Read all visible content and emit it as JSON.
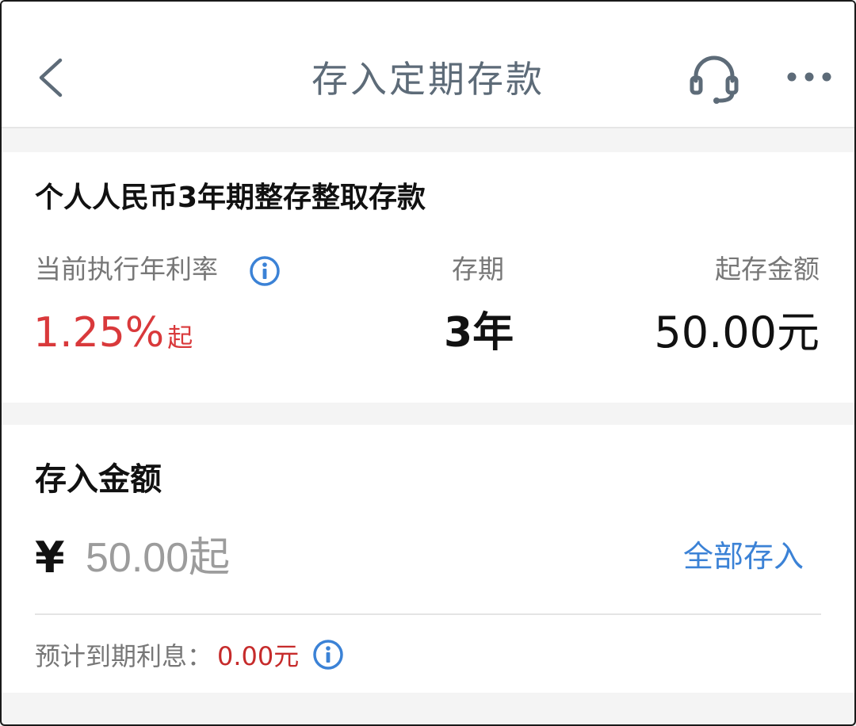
{
  "nav": {
    "title": "存入定期存款",
    "back_icon": "chevron-left-icon",
    "support_icon": "headset-icon",
    "more_icon": "more-dots-icon"
  },
  "product": {
    "name": "个人人民币3年期整存整取存款",
    "rate_label": "当前执行年利率",
    "rate_value": "1.25%",
    "rate_suffix": "起",
    "term_label": "存期",
    "term_value": "3年",
    "min_label": "起存金额",
    "min_value": "50.00元"
  },
  "deposit": {
    "section_title": "存入金额",
    "currency_symbol": "¥",
    "amount_value": "",
    "amount_placeholder": "50.00起",
    "deposit_all_label": "全部存入",
    "interest_label": "预计到期利息：",
    "interest_value": "0.00元"
  },
  "colors": {
    "accent_blue": "#3b82d6",
    "rate_red": "#d9393b",
    "interest_red": "#c62b2b",
    "nav_gray": "#5d6b78"
  }
}
